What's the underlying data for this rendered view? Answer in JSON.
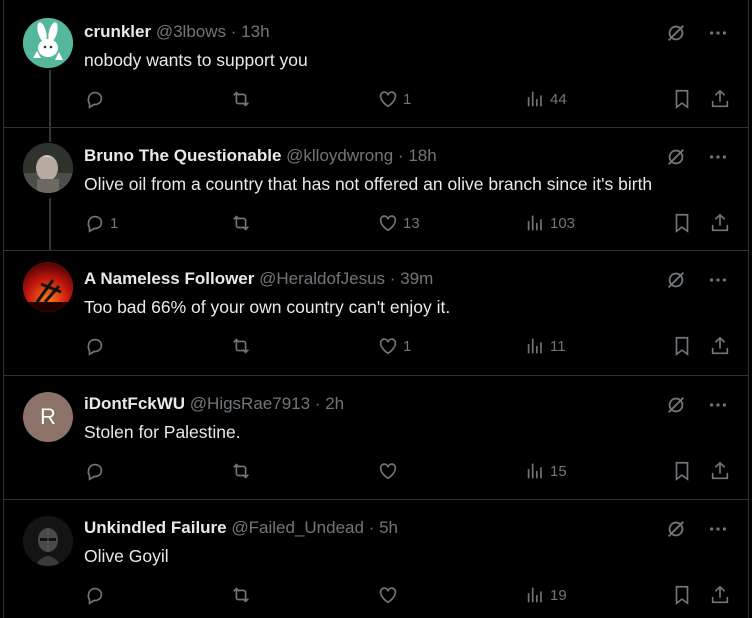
{
  "tweets": [
    {
      "name": "crunkler",
      "handle": "@3lbows",
      "time": "13h",
      "text": "nobody wants to support you",
      "replies": "",
      "retweets": "",
      "likes": "1",
      "views": "44",
      "avatar_icon": "bunny-avatar-icon",
      "avatar_color": "#4fb39a"
    },
    {
      "name": "Bruno The Questionable",
      "handle": "@klloydwrong",
      "time": "18h",
      "text": "Olive oil from a country that has not offered an olive branch since it's birth",
      "replies": "1",
      "retweets": "",
      "likes": "13",
      "views": "103",
      "avatar_icon": "person-photo-avatar",
      "avatar_color": "#3b3f3a"
    },
    {
      "name": "A Nameless Follower",
      "handle": "@HeraldofJesus",
      "time": "39m",
      "text": "Too bad 66% of your own country can't enjoy it.",
      "replies": "",
      "retweets": "",
      "likes": "1",
      "views": "11",
      "avatar_icon": "cross-sunset-avatar",
      "avatar_color": "#c4160d"
    },
    {
      "name": "iDontFckWU",
      "handle": "@HigsRae7913",
      "time": "2h",
      "text": "Stolen for Palestine.",
      "replies": "",
      "retweets": "",
      "likes": "",
      "views": "15",
      "avatar_letter": "R",
      "avatar_color": "#8d7269"
    },
    {
      "name": "Unkindled Failure",
      "handle": "@Failed_Undead",
      "time": "5h",
      "text": "Olive Goyil",
      "replies": "",
      "retweets": "",
      "likes": "",
      "views": "19",
      "avatar_icon": "knight-avatar",
      "avatar_color": "#1a1a1a"
    }
  ],
  "separator": "·",
  "colors": {
    "background": "#000000",
    "text": "#e7e9ea",
    "muted": "#71767b",
    "border": "#2f3336"
  }
}
